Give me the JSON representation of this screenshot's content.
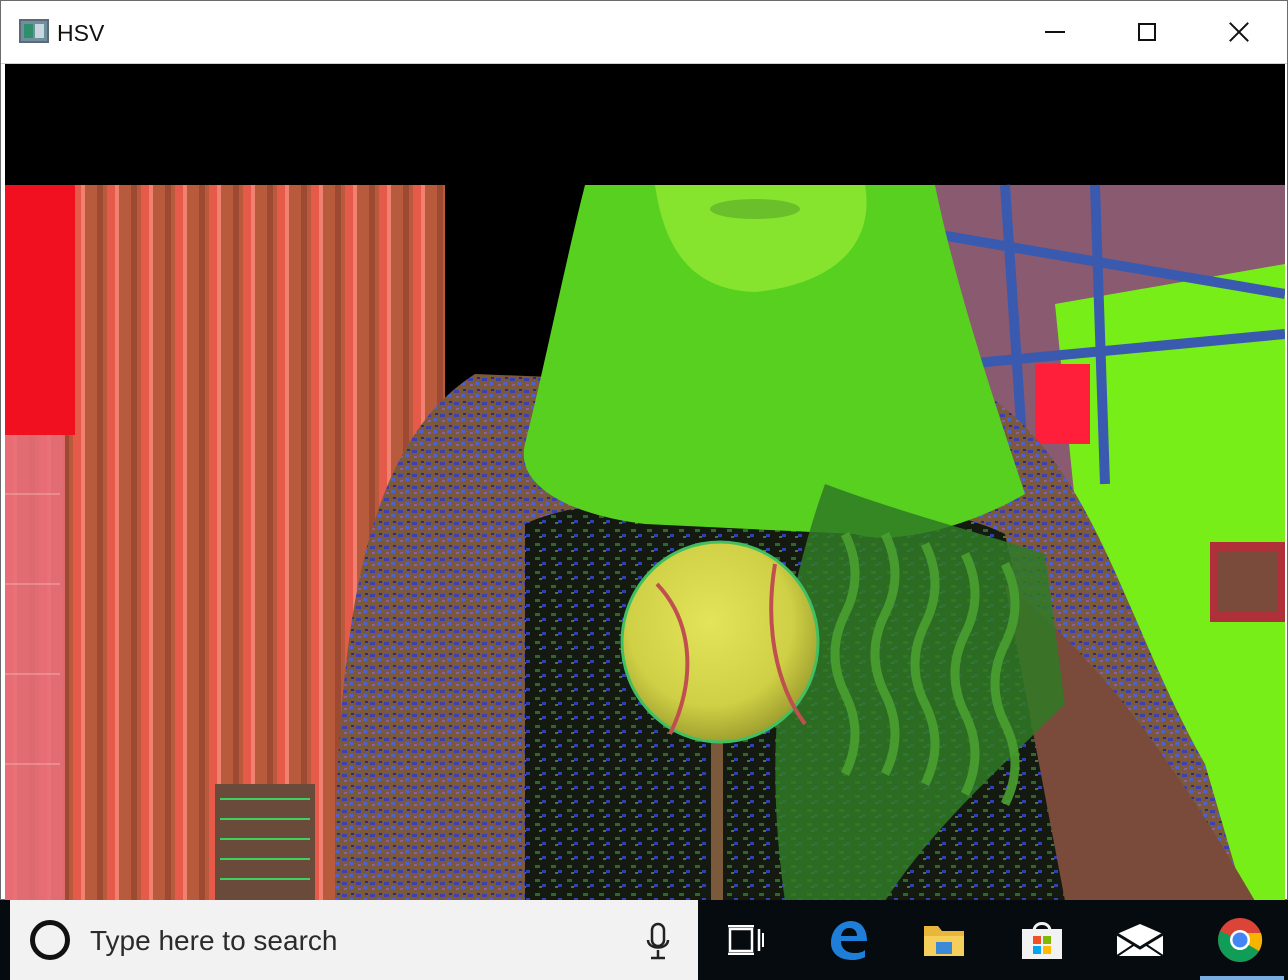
{
  "window": {
    "title": "HSV",
    "app_icon": "opencv-window-icon",
    "controls": [
      "minimize-icon",
      "maximize-icon",
      "close-icon"
    ]
  },
  "image": {
    "description_name": "hsv-video-frame"
  },
  "taskbar": {
    "search_placeholder": "Type here to search",
    "icons": [
      "cortana-icon",
      "microphone-icon",
      "task-view-icon",
      "edge-icon",
      "file-explorer-icon",
      "store-icon",
      "mail-icon",
      "chrome-icon"
    ],
    "active_app": "chrome-icon"
  },
  "colors": {
    "taskbar_bg": "#060b10",
    "search_bg": "#f2f2f2",
    "active_indicator": "#7aaee0"
  }
}
